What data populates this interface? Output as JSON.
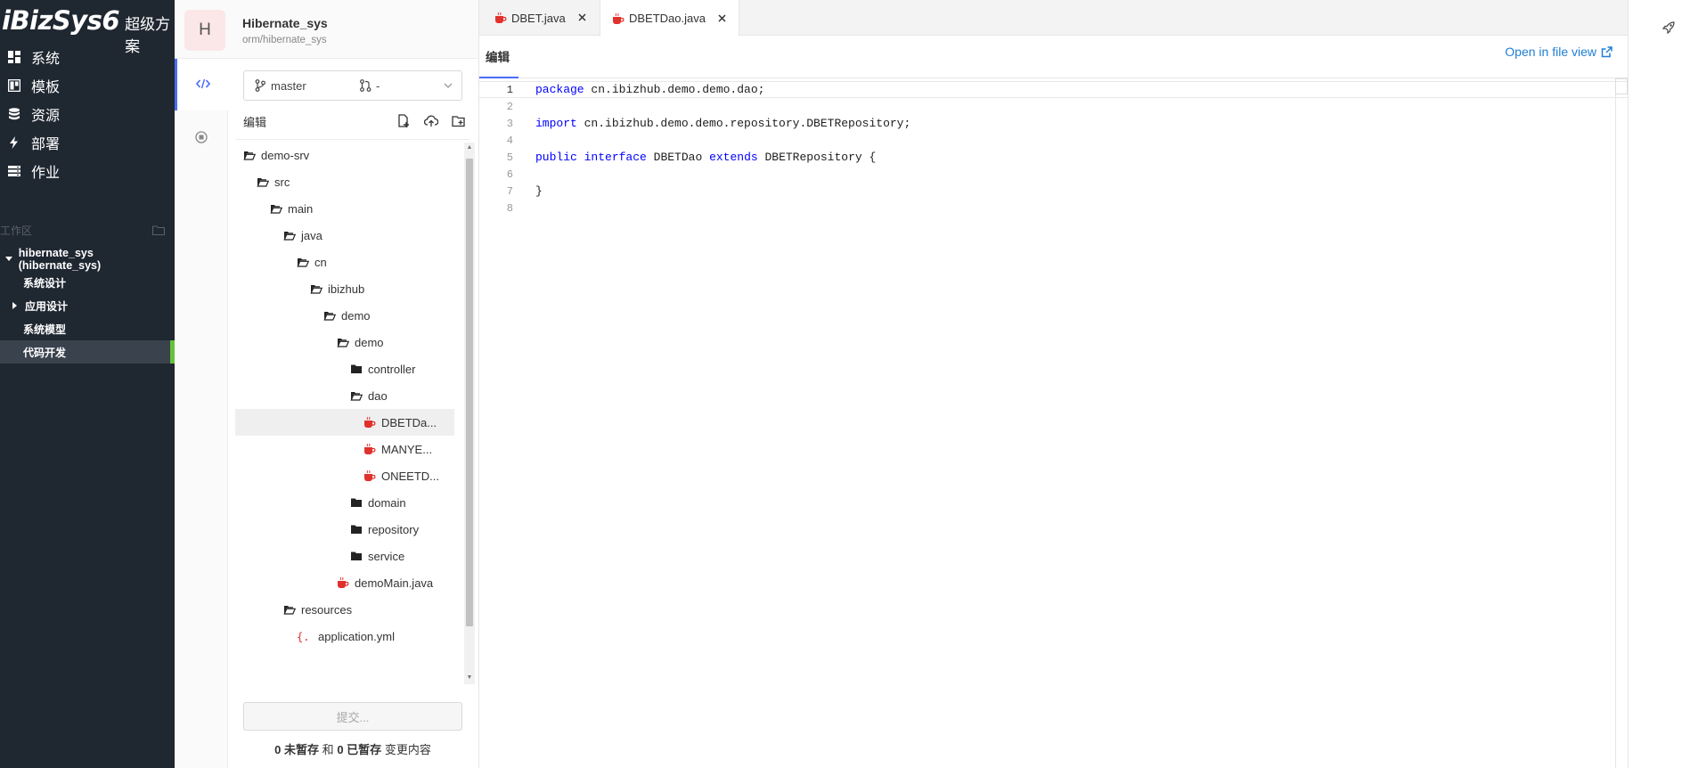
{
  "sidebar": {
    "brand": "iBizSys6",
    "brand_sub": "超级方案",
    "nav": [
      {
        "label": "系统",
        "icon": "dashboard-icon"
      },
      {
        "label": "模板",
        "icon": "board-icon"
      },
      {
        "label": "资源",
        "icon": "database-icon"
      },
      {
        "label": "部署",
        "icon": "bolt-icon"
      },
      {
        "label": "作业",
        "icon": "server-icon"
      }
    ],
    "workspace_label": "工作区",
    "workspace": {
      "root": "hibernate_sys (hibernate_sys)",
      "children": [
        "系统设计",
        "应用设计",
        "系统模型",
        "代码开发"
      ]
    }
  },
  "project": {
    "avatar_letter": "H",
    "name": "Hibernate_sys",
    "path": "orm/hibernate_sys"
  },
  "explorer": {
    "branch": "master",
    "commit_ref": "-",
    "edit_label": "编辑",
    "tree": [
      {
        "label": "demo-srv",
        "icon": "folder-open-icon",
        "depth": 0
      },
      {
        "label": "src",
        "icon": "folder-open-icon",
        "depth": 1
      },
      {
        "label": "main",
        "icon": "folder-open-icon",
        "depth": 2
      },
      {
        "label": "java",
        "icon": "folder-open-icon",
        "depth": 3
      },
      {
        "label": "cn",
        "icon": "folder-open-icon",
        "depth": 4
      },
      {
        "label": "ibizhub",
        "icon": "folder-open-icon",
        "depth": 5
      },
      {
        "label": "demo",
        "icon": "folder-open-icon",
        "depth": 6
      },
      {
        "label": "demo",
        "icon": "folder-open-icon",
        "depth": 7
      },
      {
        "label": "controller",
        "icon": "folder-icon",
        "depth": 8
      },
      {
        "label": "dao",
        "icon": "folder-open-icon",
        "depth": 8
      },
      {
        "label": "DBETDa...",
        "icon": "java-file-icon",
        "depth": 9,
        "selected": true
      },
      {
        "label": "MANYE...",
        "icon": "java-file-icon",
        "depth": 9
      },
      {
        "label": "ONEETD...",
        "icon": "java-file-icon",
        "depth": 9
      },
      {
        "label": "domain",
        "icon": "folder-icon",
        "depth": 8
      },
      {
        "label": "repository",
        "icon": "folder-icon",
        "depth": 8
      },
      {
        "label": "service",
        "icon": "folder-icon",
        "depth": 8
      },
      {
        "label": "demoMain.java",
        "icon": "java-file-icon",
        "depth": 7
      },
      {
        "label": "resources",
        "icon": "folder-open-icon",
        "depth": 3
      },
      {
        "label": "application.yml",
        "icon": "json-file-icon",
        "depth": 4
      }
    ],
    "commit_button": "提交...",
    "changes": {
      "unstaged_count": "0",
      "unstaged_label": "未暂存",
      "and": "和",
      "staged_count": "0",
      "staged_label": "已暂存",
      "suffix": "变更内容"
    }
  },
  "editor": {
    "tabs": [
      {
        "label": "DBET.java",
        "active": false
      },
      {
        "label": "DBETDao.java",
        "active": true
      }
    ],
    "title": "编辑",
    "open_link": "Open in file view",
    "current_line": 1,
    "lines": [
      [
        {
          "t": "package",
          "k": true
        },
        {
          "t": " cn.ibizhub.demo.demo.dao;"
        }
      ],
      [],
      [
        {
          "t": "import",
          "k": true
        },
        {
          "t": " cn.ibizhub.demo.demo.repository.DBETRepository;"
        }
      ],
      [],
      [
        {
          "t": "public",
          "k": true
        },
        {
          "t": " "
        },
        {
          "t": "interface",
          "k": true
        },
        {
          "t": " DBETDao "
        },
        {
          "t": "extends",
          "k": true
        },
        {
          "t": " DBETRepository {"
        }
      ],
      [],
      [
        {
          "t": "}"
        }
      ],
      []
    ]
  },
  "colors": {
    "sidebar_bg": "#1f2731",
    "active_indicator": "#67c23a",
    "accent": "#4a6cf7",
    "link": "#1f7ed2",
    "java_icon": "#e0312c",
    "keyword": "#0000ff"
  }
}
